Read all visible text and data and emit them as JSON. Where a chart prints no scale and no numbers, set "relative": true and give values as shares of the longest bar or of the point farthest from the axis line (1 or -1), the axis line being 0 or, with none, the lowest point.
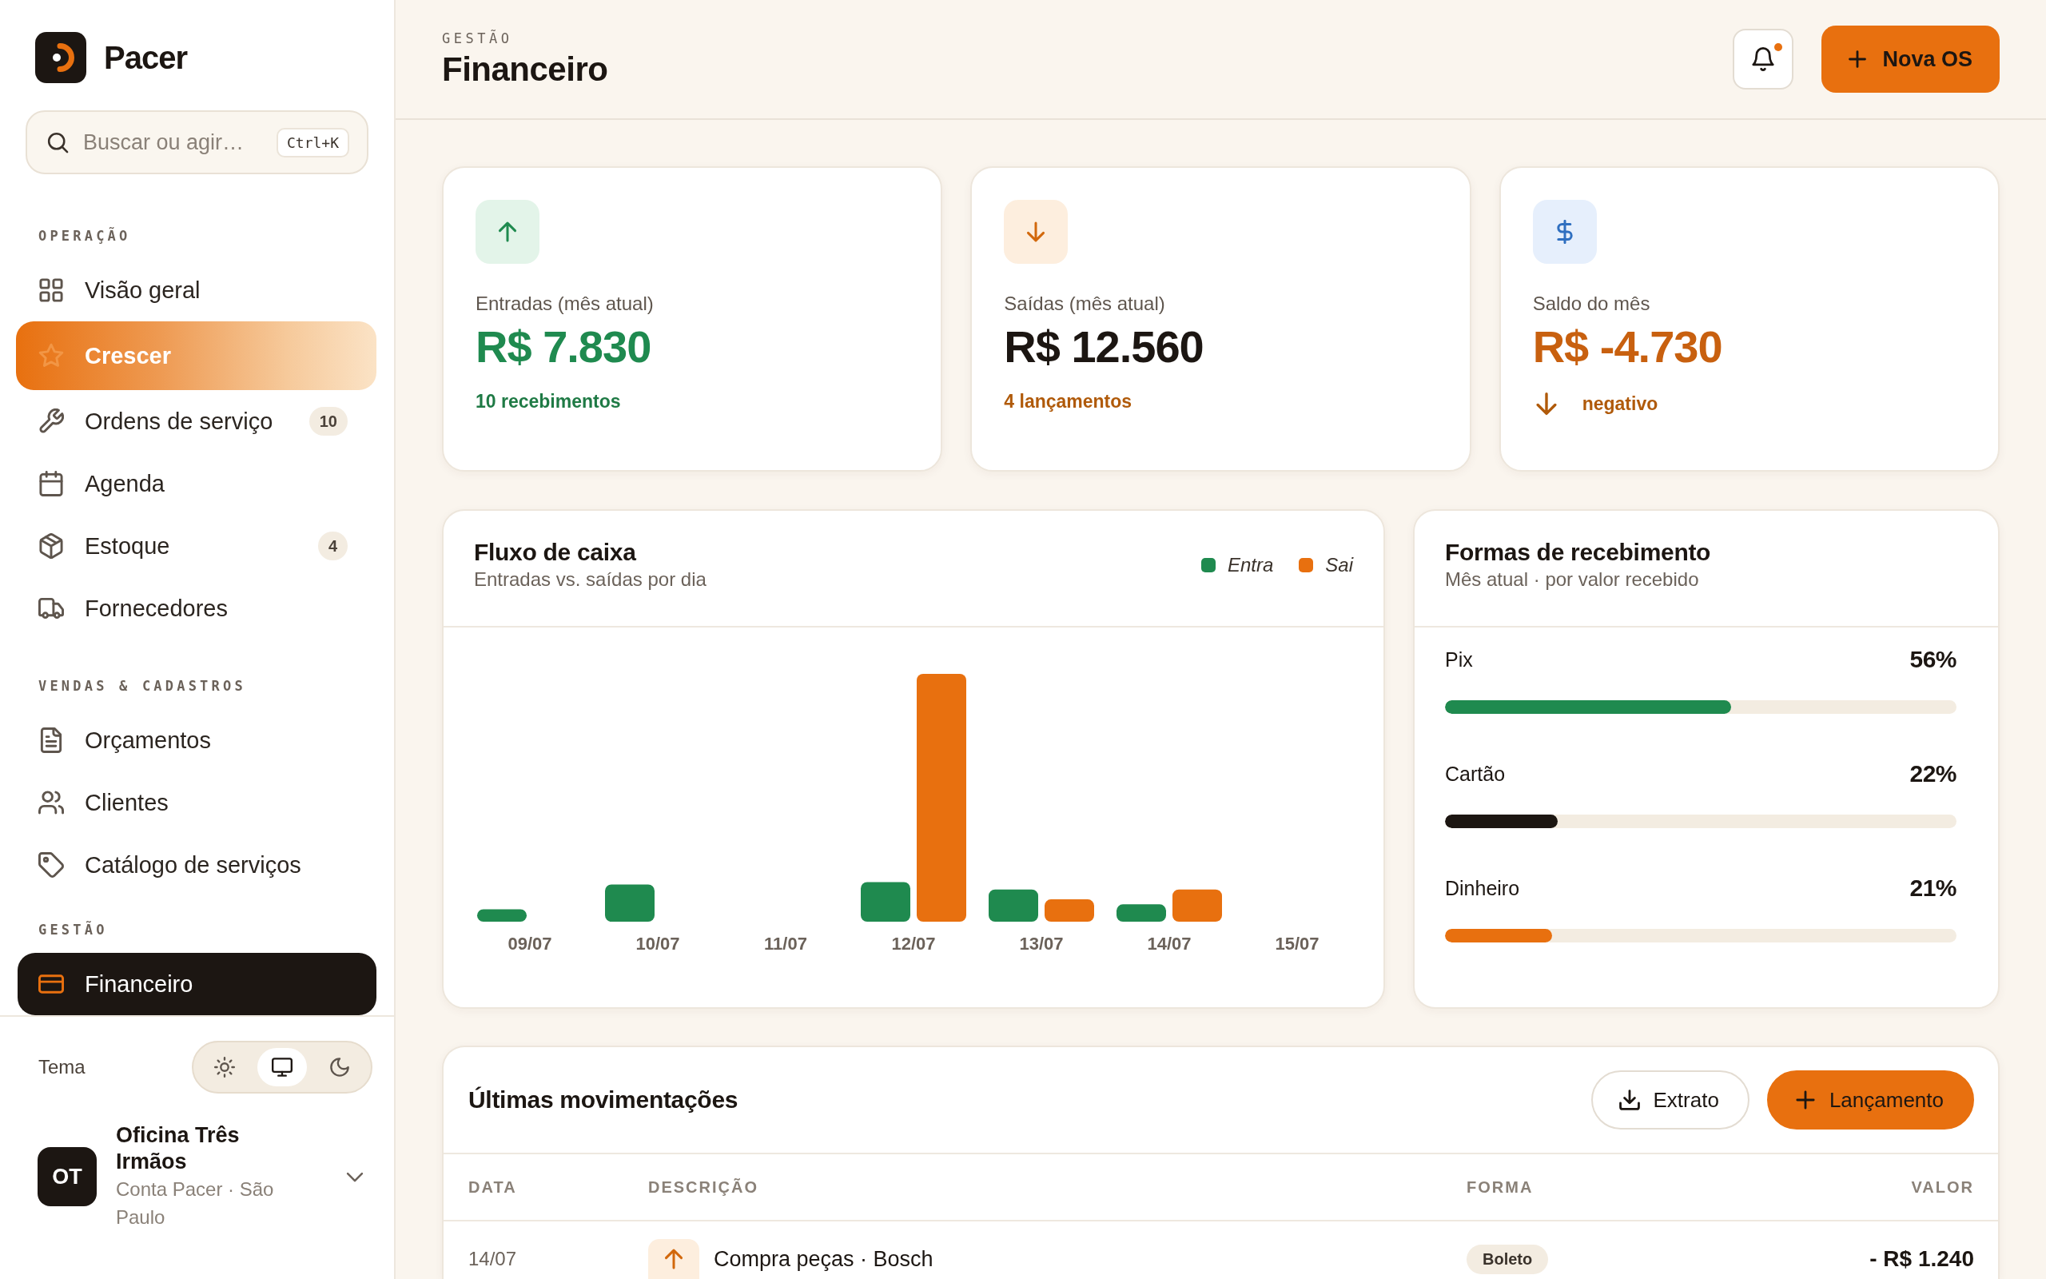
{
  "sidebar": {
    "brand": {
      "name": "Pacer"
    },
    "search": {
      "placeholder": "Buscar ou agir…",
      "shortcut": "Ctrl+K"
    },
    "sections": [
      {
        "title": "OPERAÇÃO",
        "items": [
          {
            "label": "Visão geral",
            "kind": "link",
            "selected": false
          },
          {
            "label": "Crescer",
            "kind": "featured",
            "selected": false
          },
          {
            "label": "Ordens de serviço",
            "kind": "link",
            "selected": false,
            "badge": "10"
          },
          {
            "label": "Agenda",
            "kind": "link",
            "selected": false
          },
          {
            "label": "Estoque",
            "kind": "link",
            "selected": false,
            "badge": "4"
          },
          {
            "label": "Fornecedores",
            "kind": "link",
            "selected": false
          }
        ]
      },
      {
        "title": "VENDAS & CADASTROS",
        "items": [
          {
            "label": "Orçamentos",
            "kind": "link",
            "selected": false
          },
          {
            "label": "Clientes",
            "kind": "link",
            "selected": false
          },
          {
            "label": "Catálogo de serviços",
            "kind": "link",
            "selected": false
          }
        ]
      },
      {
        "title": "GESTÃO",
        "items": [
          {
            "label": "Financeiro",
            "kind": "link",
            "selected": true
          }
        ]
      }
    ],
    "theme": {
      "label": "Tema",
      "options": [
        {
          "selected": false
        },
        {
          "selected": true
        },
        {
          "selected": false
        }
      ]
    },
    "account": {
      "initials": "OT",
      "name": "Oficina Três Irmãos",
      "subtitle": "Conta Pacer · São Paulo"
    }
  },
  "header": {
    "eyebrow": "GESTÃO",
    "title": "Financeiro",
    "notifications": {
      "unread": true
    },
    "primary_action": {
      "label": "Nova OS"
    }
  },
  "stats": [
    {
      "kind": "income",
      "label": "Entradas (mês atual)",
      "value": "R$ 7.830",
      "note": "10 recebimentos"
    },
    {
      "kind": "expense",
      "label": "Saídas (mês atual)",
      "value": "R$ 12.560",
      "note": "4 lançamentos"
    },
    {
      "kind": "balance",
      "label": "Saldo do mês",
      "value": "R$ -4.730",
      "note": "negativo",
      "trend_down": true
    }
  ],
  "cashflow": {
    "title": "Fluxo de caixa",
    "subtitle": "Entradas vs. saídas por dia",
    "chart_data": {
      "type": "bar",
      "relative": true,
      "categories": [
        "09/07",
        "10/07",
        "11/07",
        "12/07",
        "13/07",
        "14/07",
        "15/07"
      ],
      "series": [
        {
          "name": "Entra",
          "color": "#1f8a4f",
          "values": [
            0.05,
            0.15,
            0,
            0.16,
            0.13,
            0.07,
            0
          ]
        },
        {
          "name": "Sai",
          "color": "#e8700f",
          "values": [
            0,
            0,
            0,
            1,
            0.09,
            0.13,
            0
          ]
        }
      ]
    }
  },
  "payment_methods": {
    "title": "Formas de recebimento",
    "subtitle": "Mês atual · por valor recebido",
    "items": [
      {
        "name": "Pix",
        "share": "56%",
        "level": 0.56,
        "color": "#1f8a4f"
      },
      {
        "name": "Cartão",
        "share": "22%",
        "level": 0.22,
        "color": "#1c1612"
      },
      {
        "name": "Dinheiro",
        "share": "21%",
        "level": 0.21,
        "color": "#e8700f"
      }
    ]
  },
  "transactions": {
    "title": "Últimas movimentações",
    "actions": [
      {
        "kind": "secondary",
        "label": "Extrato"
      },
      {
        "kind": "primary",
        "label": "Lançamento"
      }
    ],
    "columns": [
      "DATA",
      "DESCRIÇÃO",
      "FORMA",
      "VALOR"
    ],
    "rows": [
      {
        "kind": "expense",
        "date": "14/07",
        "description": "Compra peças · Bosch",
        "method": "Boleto",
        "amount": "- R$ 1.240"
      }
    ]
  }
}
